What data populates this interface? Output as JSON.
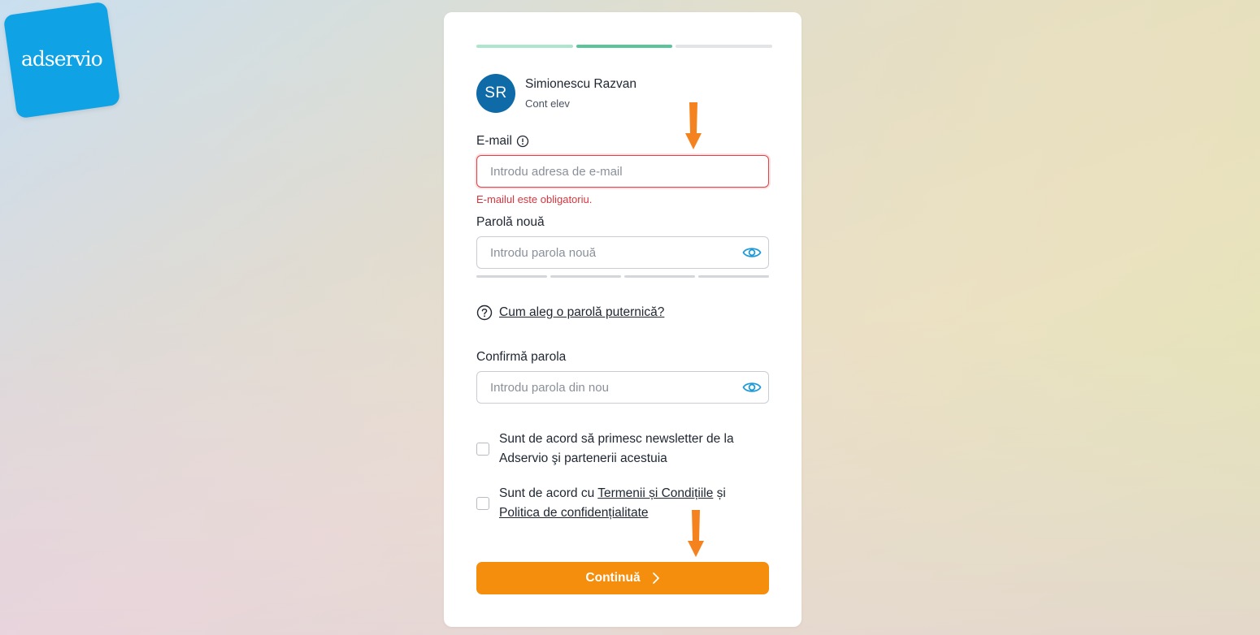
{
  "brand": {
    "logo_text": "adservio",
    "color": "#0fa3e6"
  },
  "progress_steps": [
    {
      "state": "complete",
      "color": "#aee6cd"
    },
    {
      "state": "current",
      "color": "#5cc49a"
    },
    {
      "state": "pending",
      "color": "#e2e4e7"
    }
  ],
  "user": {
    "initials": "SR",
    "name": "Simionescu Razvan",
    "role": "Cont elev"
  },
  "email": {
    "label": "E-mail",
    "info_icon": "info-icon",
    "placeholder": "Introdu adresa de e-mail",
    "value": "",
    "error": "E-mailul este obligatoriu."
  },
  "new_password": {
    "label": "Parolă nouă",
    "placeholder": "Introdu parola nouă",
    "value": "",
    "toggle_icon": "eye-icon",
    "strength_segments_filled": 0,
    "strength_segments_total": 4
  },
  "password_help": {
    "icon": "question-icon",
    "link": "Cum aleg o parolă puternică?"
  },
  "confirm_password": {
    "label": "Confirmă parola",
    "placeholder": "Introdu parola din nou",
    "value": "",
    "toggle_icon": "eye-icon"
  },
  "consents": {
    "newsletter": {
      "checked": false,
      "text": "Sunt de acord să primesc newsletter de la Adservio şi partenerii acestuia"
    },
    "terms": {
      "checked": false,
      "prefix": "Sunt de acord cu ",
      "terms_link": "Termenii și Condițiile",
      "middle": " și ",
      "privacy_link": "Politica de confidențialitate"
    }
  },
  "continue_button": {
    "label": "Continuă",
    "icon": "chevron-right-icon",
    "color": "#f58e0c"
  },
  "annotation_arrows": {
    "color": "#f4821f"
  }
}
